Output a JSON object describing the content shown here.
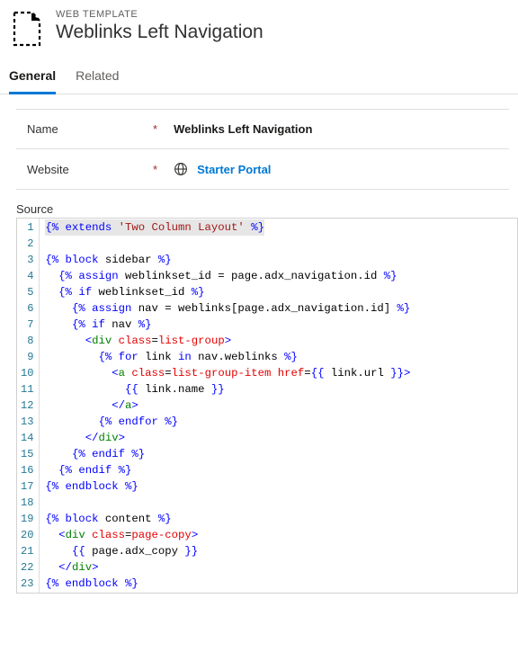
{
  "header": {
    "eyebrow": "WEB TEMPLATE",
    "title": "Weblinks Left Navigation"
  },
  "tabs": [
    {
      "label": "General",
      "active": true
    },
    {
      "label": "Related",
      "active": false
    }
  ],
  "form": {
    "name_label": "Name",
    "name_value": "Weblinks Left Navigation",
    "website_label": "Website",
    "website_value": "Starter Portal"
  },
  "source_label": "Source",
  "code": {
    "lines": [
      [
        [
          "hl",
          "{%"
        ],
        [
          "kw",
          " extends "
        ],
        [
          "str",
          "'Two Column Layout'"
        ],
        [
          "hl",
          " %}"
        ]
      ],
      [],
      [
        [
          "delim",
          "{%"
        ],
        [
          "kw",
          " block"
        ],
        [
          "id",
          " sidebar "
        ],
        [
          "delim",
          "%}"
        ]
      ],
      [
        [
          "sp",
          "  "
        ],
        [
          "delim",
          "{%"
        ],
        [
          "kw",
          " assign"
        ],
        [
          "id",
          " weblinkset_id = page.adx_navigation.id "
        ],
        [
          "delim",
          "%}"
        ]
      ],
      [
        [
          "sp",
          "  "
        ],
        [
          "delim",
          "{%"
        ],
        [
          "kw",
          " if"
        ],
        [
          "id",
          " weblinkset_id "
        ],
        [
          "delim",
          "%}"
        ]
      ],
      [
        [
          "sp",
          "    "
        ],
        [
          "delim",
          "{%"
        ],
        [
          "kw",
          " assign"
        ],
        [
          "id",
          " nav = weblinks[page.adx_navigation.id] "
        ],
        [
          "delim",
          "%}"
        ]
      ],
      [
        [
          "sp",
          "    "
        ],
        [
          "delim",
          "{%"
        ],
        [
          "kw",
          " if"
        ],
        [
          "id",
          " nav "
        ],
        [
          "delim",
          "%}"
        ]
      ],
      [
        [
          "sp",
          "      "
        ],
        [
          "tag",
          "<"
        ],
        [
          "elem",
          "div"
        ],
        [
          "id",
          " "
        ],
        [
          "attr",
          "class"
        ],
        [
          "id",
          "="
        ],
        [
          "attr",
          "list-group"
        ],
        [
          "tag",
          ">"
        ]
      ],
      [
        [
          "sp",
          "        "
        ],
        [
          "delim",
          "{%"
        ],
        [
          "kw",
          " for"
        ],
        [
          "id",
          " link "
        ],
        [
          "kw",
          "in"
        ],
        [
          "id",
          " nav.weblinks "
        ],
        [
          "delim",
          "%}"
        ]
      ],
      [
        [
          "sp",
          "          "
        ],
        [
          "tag",
          "<"
        ],
        [
          "elem",
          "a"
        ],
        [
          "id",
          " "
        ],
        [
          "attr",
          "class"
        ],
        [
          "id",
          "="
        ],
        [
          "attr",
          "list-group-item"
        ],
        [
          "id",
          " "
        ],
        [
          "attr",
          "href"
        ],
        [
          "id",
          "="
        ],
        [
          "delim",
          "{{"
        ],
        [
          "id",
          " link.url "
        ],
        [
          "delim",
          "}}"
        ],
        [
          "tag",
          ">"
        ]
      ],
      [
        [
          "sp",
          "            "
        ],
        [
          "delim",
          "{{"
        ],
        [
          "id",
          " link.name "
        ],
        [
          "delim",
          "}}"
        ]
      ],
      [
        [
          "sp",
          "          "
        ],
        [
          "tag",
          "</"
        ],
        [
          "elem",
          "a"
        ],
        [
          "tag",
          ">"
        ]
      ],
      [
        [
          "sp",
          "        "
        ],
        [
          "delim",
          "{%"
        ],
        [
          "kw",
          " endfor "
        ],
        [
          "delim",
          "%}"
        ]
      ],
      [
        [
          "sp",
          "      "
        ],
        [
          "tag",
          "</"
        ],
        [
          "elem",
          "div"
        ],
        [
          "tag",
          ">"
        ]
      ],
      [
        [
          "sp",
          "    "
        ],
        [
          "delim",
          "{%"
        ],
        [
          "kw",
          " endif "
        ],
        [
          "delim",
          "%}"
        ]
      ],
      [
        [
          "sp",
          "  "
        ],
        [
          "delim",
          "{%"
        ],
        [
          "kw",
          " endif "
        ],
        [
          "delim",
          "%}"
        ]
      ],
      [
        [
          "delim",
          "{%"
        ],
        [
          "kw",
          " endblock "
        ],
        [
          "delim",
          "%}"
        ]
      ],
      [],
      [
        [
          "delim",
          "{%"
        ],
        [
          "kw",
          " block"
        ],
        [
          "id",
          " content "
        ],
        [
          "delim",
          "%}"
        ]
      ],
      [
        [
          "sp",
          "  "
        ],
        [
          "tag",
          "<"
        ],
        [
          "elem",
          "div"
        ],
        [
          "id",
          " "
        ],
        [
          "attr",
          "class"
        ],
        [
          "id",
          "="
        ],
        [
          "attr",
          "page-copy"
        ],
        [
          "tag",
          ">"
        ]
      ],
      [
        [
          "sp",
          "    "
        ],
        [
          "delim",
          "{{"
        ],
        [
          "id",
          " page.adx_copy "
        ],
        [
          "delim",
          "}}"
        ]
      ],
      [
        [
          "sp",
          "  "
        ],
        [
          "tag",
          "</"
        ],
        [
          "elem",
          "div"
        ],
        [
          "tag",
          ">"
        ]
      ],
      [
        [
          "delim",
          "{%"
        ],
        [
          "kw",
          " endblock "
        ],
        [
          "delim",
          "%}"
        ]
      ]
    ]
  }
}
